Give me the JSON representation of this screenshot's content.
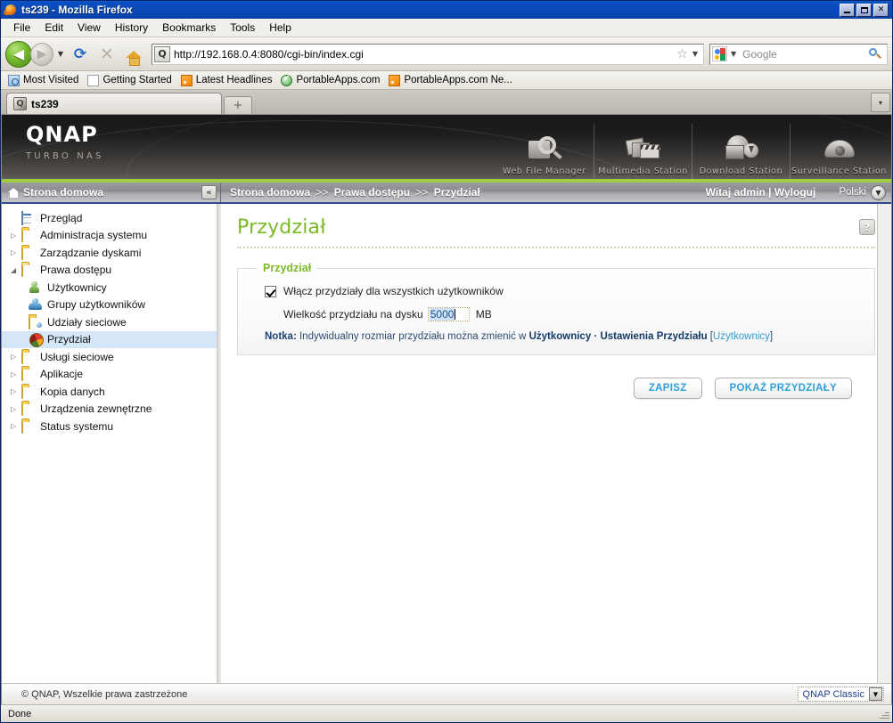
{
  "window": {
    "title": "ts239 - Mozilla Firefox",
    "icon": "firefox-icon",
    "minimize_label": "_",
    "maximize_label": "□",
    "close_label": "✕"
  },
  "menubar": {
    "items": [
      "File",
      "Edit",
      "View",
      "History",
      "Bookmarks",
      "Tools",
      "Help"
    ]
  },
  "navbar": {
    "back_label": "◀",
    "forward_label": "▶",
    "dropdown_label": "▼",
    "reload_label": "⟳",
    "stop_label": "✕",
    "home_label": "home-icon",
    "url": "http://192.168.0.4:8080/cgi-bin/index.cgi",
    "favicon_label": "Q",
    "star_label": "☆",
    "url_caret": "▼",
    "search_placeholder": "Google",
    "search_engine": "Google",
    "search_value": ""
  },
  "bookmarks": {
    "items": [
      {
        "label": "Most Visited",
        "icon": "most-visited-icon"
      },
      {
        "label": "Getting Started",
        "icon": "page-icon"
      },
      {
        "label": "Latest Headlines",
        "icon": "rss-icon"
      },
      {
        "label": "PortableApps.com",
        "icon": "portableapps-icon"
      },
      {
        "label": "PortableApps.com Ne...",
        "icon": "rss-icon"
      }
    ]
  },
  "tabbar": {
    "tabs": [
      {
        "label": "ts239",
        "icon": "qnap-favicon",
        "active": true
      }
    ],
    "new_tab_label": "+",
    "tab_list_label": "▾"
  },
  "banner": {
    "logo": "QNAP",
    "tagline": "TURBO NAS",
    "apps": [
      {
        "label": "Web File Manager",
        "icon": "web-file-manager-icon"
      },
      {
        "label": "Multimedia Station",
        "icon": "multimedia-station-icon"
      },
      {
        "label": "Download Station",
        "icon": "download-station-icon"
      },
      {
        "label": "Surveillance Station",
        "icon": "surveillance-station-icon"
      }
    ]
  },
  "subheader": {
    "home_label": "Strona domowa",
    "collapse_label": "«",
    "breadcrumb": [
      "Strona domowa",
      "Prawa dostępu",
      "Przydział"
    ],
    "breadcrumb_separator": ">>",
    "welcome": "Witaj admin | Wyloguj",
    "language": "Polski",
    "language_caret": "▼"
  },
  "sidebar": {
    "items": [
      {
        "label": "Przegląd",
        "icon": "overview-icon",
        "twisty": "",
        "level": 1,
        "selected": false
      },
      {
        "label": "Administracja systemu",
        "icon": "folder-icon",
        "twisty": "▷",
        "level": 1,
        "selected": false
      },
      {
        "label": "Zarządzanie dyskami",
        "icon": "folder-icon",
        "twisty": "▷",
        "level": 1,
        "selected": false
      },
      {
        "label": "Prawa dostępu",
        "icon": "folder-open-icon",
        "twisty": "◢",
        "level": 1,
        "selected": false
      },
      {
        "label": "Użytkownicy",
        "icon": "user-icon",
        "twisty": "",
        "level": 2,
        "selected": false
      },
      {
        "label": "Grupy użytkowników",
        "icon": "user-group-icon",
        "twisty": "",
        "level": 2,
        "selected": false
      },
      {
        "label": "Udziały sieciowe",
        "icon": "shared-folder-icon",
        "twisty": "",
        "level": 2,
        "selected": false
      },
      {
        "label": "Przydział",
        "icon": "quota-pie-icon",
        "twisty": "",
        "level": 2,
        "selected": true
      },
      {
        "label": "Usługi sieciowe",
        "icon": "folder-icon",
        "twisty": "▷",
        "level": 1,
        "selected": false
      },
      {
        "label": "Aplikacje",
        "icon": "folder-icon",
        "twisty": "▷",
        "level": 1,
        "selected": false
      },
      {
        "label": "Kopia danych",
        "icon": "folder-icon",
        "twisty": "▷",
        "level": 1,
        "selected": false
      },
      {
        "label": "Urządzenia zewnętrzne",
        "icon": "folder-icon",
        "twisty": "▷",
        "level": 1,
        "selected": false
      },
      {
        "label": "Status systemu",
        "icon": "folder-icon",
        "twisty": "▷",
        "level": 1,
        "selected": false
      }
    ]
  },
  "content": {
    "page_title": "Przydział",
    "help_label": "?",
    "fieldset_legend": "Przydział",
    "enable_checkbox_label": "Włącz przydziały dla wszystkich użytkowników",
    "enable_checkbox_checked": true,
    "size_label": "Wielkość przydziału na dysku",
    "size_value": "5000",
    "size_unit": "MB",
    "note_prefix": "Notka:",
    "note_text": "Indywidualny rozmiar przydziału można zmienić w",
    "note_strong": "Użytkownicy · Ustawienia Przydziału",
    "note_bracket_open": "[",
    "note_link": "Użytkownicy",
    "note_bracket_close": "]",
    "save_label": "ZAPISZ",
    "show_quotas_label": "POKAŻ PRZYDZIAŁY"
  },
  "page_footer": {
    "copyright": "© QNAP, Wszelkie prawa zastrzeżone",
    "theme_value": "QNAP Classic",
    "theme_caret": "▼"
  },
  "statusbar": {
    "status": "Done"
  },
  "colors": {
    "qnap_green": "#9fce43",
    "title_green": "#7cb928",
    "button_blue": "#2f9fd6",
    "titlebar_blue": "#0a46ae",
    "selected_row": "#d4e6f7"
  }
}
